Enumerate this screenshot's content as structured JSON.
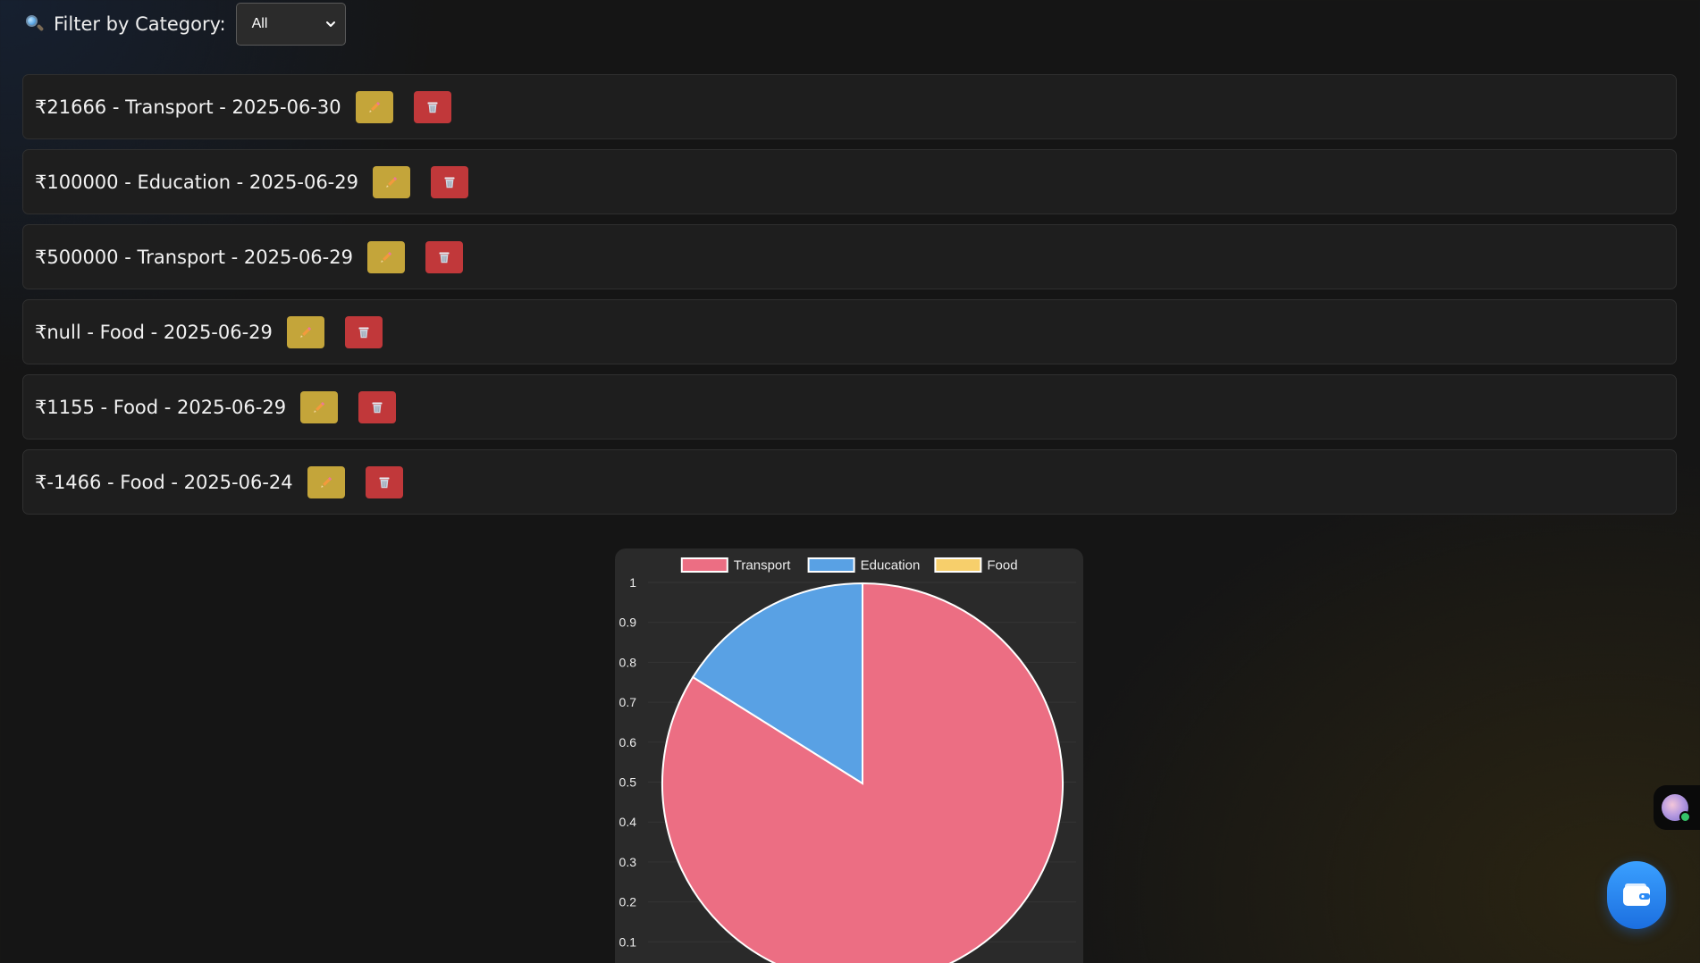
{
  "filter": {
    "label": "Filter by Category:",
    "icon": "search-icon",
    "selected": "All"
  },
  "expenses": [
    {
      "text": "₹21666 - Transport - 2025-06-30",
      "edit_icon": "pencil-icon",
      "delete_icon": "trash-icon"
    },
    {
      "text": "₹100000 - Education - 2025-06-29",
      "edit_icon": "pencil-icon",
      "delete_icon": "trash-icon"
    },
    {
      "text": "₹500000 - Transport - 2025-06-29",
      "edit_icon": "pencil-icon",
      "delete_icon": "trash-icon"
    },
    {
      "text": "₹null - Food - 2025-06-29",
      "edit_icon": "pencil-icon",
      "delete_icon": "trash-icon"
    },
    {
      "text": "₹1155 - Food - 2025-06-29",
      "edit_icon": "pencil-icon",
      "delete_icon": "trash-icon"
    },
    {
      "text": "₹-1466 - Food - 2025-06-24",
      "edit_icon": "pencil-icon",
      "delete_icon": "trash-icon"
    }
  ],
  "colors": {
    "edit_button": "#c4a53a",
    "delete_button": "#c1383a",
    "fab": "#2b8af5"
  },
  "chart_data": {
    "type": "pie",
    "categories": [
      "Transport",
      "Education",
      "Food"
    ],
    "values": [
      521666,
      100000,
      0
    ],
    "colors": [
      "#ec6e83",
      "#59a1e4",
      "#f7cf6b"
    ],
    "legend_position": "top",
    "y_ticks": [
      "1",
      "0.9",
      "0.8",
      "0.7",
      "0.6",
      "0.5",
      "0.4",
      "0.3",
      "0.2",
      "0.1"
    ],
    "ylim": [
      0,
      1
    ],
    "grid": true
  },
  "widgets": {
    "avatar_icon": "assistant-avatar-icon",
    "fab_icon": "wallet-icon"
  }
}
